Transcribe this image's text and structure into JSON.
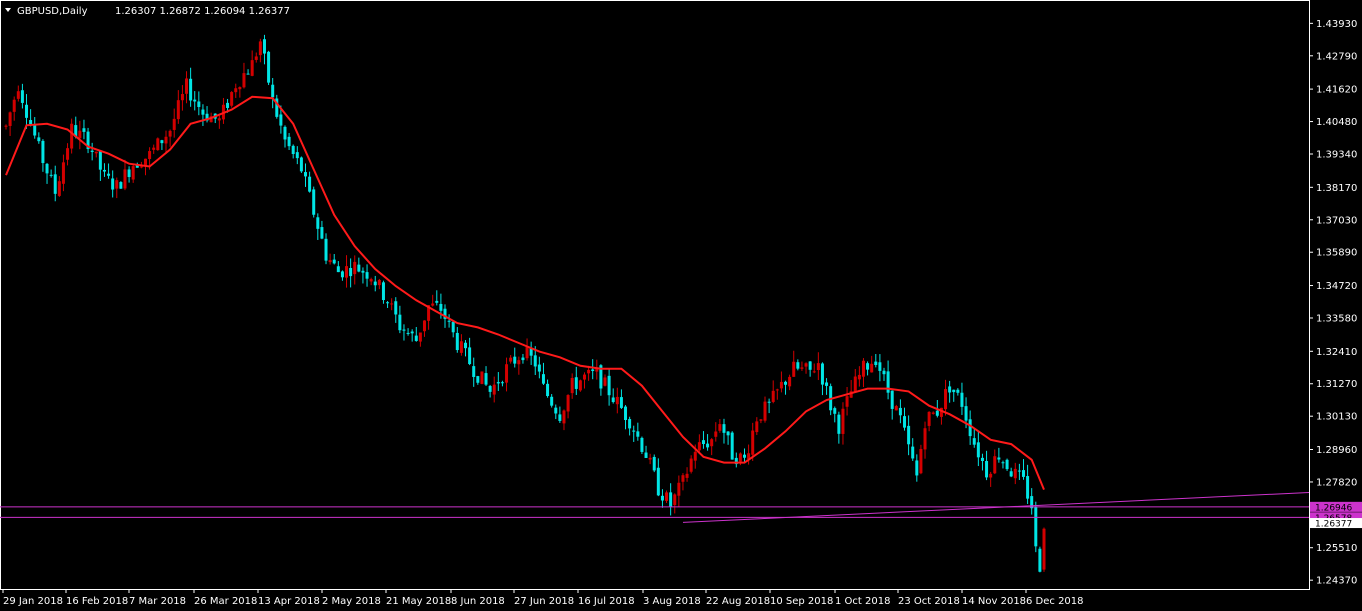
{
  "header": {
    "symbol": "GBPUSD,Daily",
    "ohlc": "1.26307 1.26872 1.26094 1.26377"
  },
  "colors": {
    "background": "#000000",
    "bull": "#d40000",
    "bear": "#00e5e5",
    "ma": "#ff1a1a",
    "levels": "#cc33cc",
    "axis": "#ffffff"
  },
  "chart_data": {
    "type": "candlestick",
    "symbol": "GBPUSD",
    "timeframe": "Daily",
    "y_ticks": [
      "1.43930",
      "1.42790",
      "1.41620",
      "1.40480",
      "1.39340",
      "1.38170",
      "1.37030",
      "1.35890",
      "1.34720",
      "1.33580",
      "1.32410",
      "1.31270",
      "1.30130",
      "1.28960",
      "1.27820",
      "1.25510",
      "1.24370"
    ],
    "ylim": [
      1.2406,
      1.4475
    ],
    "x_labels": [
      "29 Jan 2018",
      "16 Feb 2018",
      "7 Mar 2018",
      "26 Mar 2018",
      "13 Apr 2018",
      "2 May 2018",
      "21 May 2018",
      "8 Jun 2018",
      "27 Jun 2018",
      "16 Jul 2018",
      "3 Aug 2018",
      "22 Aug 2018",
      "10 Sep 2018",
      "1 Oct 2018",
      "23 Oct 2018",
      "14 Nov 2018",
      "6 Dec 2018"
    ],
    "price_badges": [
      {
        "label": "1.26946",
        "value": 1.26946,
        "color": "#cc33cc"
      },
      {
        "label": "1.26578",
        "value": 1.26578,
        "color": "#cc33cc"
      },
      {
        "label": "1.26377",
        "value": 1.26377,
        "color": "#ffffff"
      }
    ],
    "horizontal_levels": [
      1.26946,
      1.26578
    ],
    "trendline": {
      "from": [
        "3 Aug 2018",
        1.264
      ],
      "to": [
        "end",
        1.2745
      ]
    },
    "ma_anchors": [
      [
        0,
        1.386
      ],
      [
        5,
        1.4035
      ],
      [
        10,
        1.404
      ],
      [
        15,
        1.402
      ],
      [
        20,
        1.396
      ],
      [
        25,
        1.3935
      ],
      [
        30,
        1.39
      ],
      [
        35,
        1.389
      ],
      [
        40,
        1.395
      ],
      [
        45,
        1.404
      ],
      [
        50,
        1.406
      ],
      [
        55,
        1.409
      ],
      [
        60,
        1.4135
      ],
      [
        65,
        1.413
      ],
      [
        70,
        1.404
      ],
      [
        75,
        1.388
      ],
      [
        80,
        1.372
      ],
      [
        85,
        1.361
      ],
      [
        90,
        1.353
      ],
      [
        95,
        1.347
      ],
      [
        100,
        1.342
      ],
      [
        105,
        1.338
      ],
      [
        110,
        1.334
      ],
      [
        115,
        1.3325
      ],
      [
        120,
        1.33
      ],
      [
        125,
        1.327
      ],
      [
        130,
        1.324
      ],
      [
        135,
        1.322
      ],
      [
        140,
        1.319
      ],
      [
        145,
        1.318
      ],
      [
        150,
        1.318
      ],
      [
        155,
        1.312
      ],
      [
        160,
        1.303
      ],
      [
        165,
        1.294
      ],
      [
        170,
        1.287
      ],
      [
        175,
        1.285
      ],
      [
        180,
        1.285
      ],
      [
        185,
        1.29
      ],
      [
        190,
        1.296
      ],
      [
        195,
        1.303
      ],
      [
        200,
        1.307
      ],
      [
        205,
        1.309
      ],
      [
        210,
        1.311
      ],
      [
        215,
        1.311
      ],
      [
        220,
        1.31
      ],
      [
        225,
        1.305
      ],
      [
        230,
        1.302
      ],
      [
        235,
        1.298
      ],
      [
        240,
        1.293
      ],
      [
        245,
        1.2915
      ],
      [
        250,
        1.286
      ],
      [
        253,
        1.2755
      ]
    ],
    "ohlc_summary": "Approximately 254 daily candles from 29 Jan 2018 to mid Dec 2018; high near 1.4375 (mid Apr 2018), low near 1.2480 (Dec 2018)",
    "price_path_anchors": [
      [
        0,
        1.403
      ],
      [
        3,
        1.418
      ],
      [
        8,
        1.395
      ],
      [
        12,
        1.38
      ],
      [
        16,
        1.402
      ],
      [
        20,
        1.398
      ],
      [
        24,
        1.385
      ],
      [
        27,
        1.382
      ],
      [
        31,
        1.39
      ],
      [
        35,
        1.393
      ],
      [
        40,
        1.402
      ],
      [
        44,
        1.417
      ],
      [
        48,
        1.408
      ],
      [
        52,
        1.405
      ],
      [
        56,
        1.418
      ],
      [
        60,
        1.425
      ],
      [
        62,
        1.433
      ],
      [
        65,
        1.412
      ],
      [
        68,
        1.398
      ],
      [
        72,
        1.388
      ],
      [
        75,
        1.373
      ],
      [
        78,
        1.358
      ],
      [
        81,
        1.352
      ],
      [
        85,
        1.354
      ],
      [
        89,
        1.351
      ],
      [
        93,
        1.342
      ],
      [
        96,
        1.333
      ],
      [
        100,
        1.328
      ],
      [
        103,
        1.34
      ],
      [
        106,
        1.339
      ],
      [
        110,
        1.327
      ],
      [
        114,
        1.318
      ],
      [
        118,
        1.31
      ],
      [
        122,
        1.318
      ],
      [
        126,
        1.324
      ],
      [
        129,
        1.32
      ],
      [
        131,
        1.311
      ],
      [
        135,
        1.302
      ],
      [
        138,
        1.312
      ],
      [
        141,
        1.315
      ],
      [
        144,
        1.316
      ],
      [
        148,
        1.308
      ],
      [
        152,
        1.3
      ],
      [
        156,
        1.288
      ],
      [
        159,
        1.276
      ],
      [
        162,
        1.27
      ],
      [
        165,
        1.278
      ],
      [
        168,
        1.29
      ],
      [
        172,
        1.293
      ],
      [
        174,
        1.3
      ],
      [
        177,
        1.288
      ],
      [
        180,
        1.286
      ],
      [
        183,
        1.301
      ],
      [
        186,
        1.305
      ],
      [
        189,
        1.312
      ],
      [
        192,
        1.318
      ],
      [
        196,
        1.317
      ],
      [
        198,
        1.32
      ],
      [
        201,
        1.305
      ],
      [
        203,
        1.298
      ],
      [
        206,
        1.31
      ],
      [
        209,
        1.318
      ],
      [
        212,
        1.322
      ],
      [
        215,
        1.31
      ],
      [
        218,
        1.3
      ],
      [
        220,
        1.29
      ],
      [
        222,
        1.28
      ],
      [
        224,
        1.3
      ],
      [
        227,
        1.303
      ],
      [
        230,
        1.312
      ],
      [
        233,
        1.306
      ],
      [
        236,
        1.292
      ],
      [
        239,
        1.282
      ],
      [
        242,
        1.288
      ],
      [
        245,
        1.282
      ],
      [
        248,
        1.278
      ],
      [
        250,
        1.27
      ],
      [
        251,
        1.254
      ],
      [
        252,
        1.249
      ],
      [
        253,
        1.264
      ]
    ],
    "candle_count": 254,
    "grid": false
  }
}
